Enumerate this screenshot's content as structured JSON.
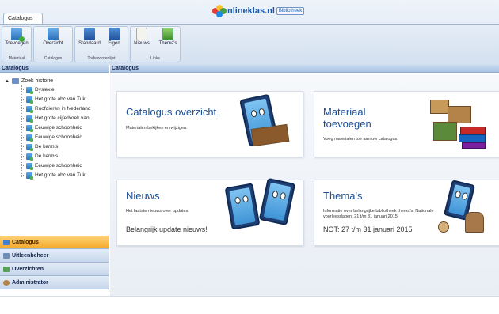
{
  "app": {
    "tab_label": "Catalogus",
    "brand_name": "nlineklas.nl",
    "brand_badge": "Bibliotheek"
  },
  "ribbon": {
    "buttons": [
      {
        "label": "Toevoegen",
        "icon": "add-document-icon"
      },
      {
        "label": "Overzicht",
        "icon": "documents-icon"
      },
      {
        "label": "Standaard",
        "icon": "tablet-icon"
      },
      {
        "label": "Eigen",
        "icon": "tablet-icon"
      },
      {
        "label": "Nieuws",
        "icon": "news-icon"
      },
      {
        "label": "Thema's",
        "icon": "image-icon"
      }
    ],
    "groups": [
      "Materiaal",
      "Catalogus",
      "Trefwoordenlijst",
      "Links"
    ]
  },
  "sidebar": {
    "header": "Catalogus",
    "tree_root": "Zoek historie",
    "tree_items": [
      "Dyslexie",
      "Het grote abc van Tuk",
      "Roofdieren in Nederland",
      "Het grote cijferboek van ...",
      "Eeuwige schoonheid",
      "Eeuwige schoonheid",
      "De kermis",
      "De kermis",
      "Eeuwige schoonheid",
      "Het grote abc van Tuk"
    ],
    "accordion": [
      {
        "label": "Catalogus",
        "active": true
      },
      {
        "label": "Uitleenbeheer",
        "active": false
      },
      {
        "label": "Overzichten",
        "active": false
      },
      {
        "label": "Administrator",
        "active": false
      }
    ]
  },
  "main": {
    "header": "Catalogus",
    "cards": [
      {
        "title": "Catalogus overzicht",
        "desc": "Materialen bekijken en wijzigen.",
        "extra": ""
      },
      {
        "title": "Materiaal toevoegen",
        "desc": "Voeg materialen toe aan uw catalogus.",
        "extra": ""
      },
      {
        "title": "Nieuws",
        "desc": "Het laatste nieuws over updates.",
        "extra": "Belangrijk update nieuws!"
      },
      {
        "title": "Thema's",
        "desc": "Informatie over belangrijke bibliotheek thema's: Nationale voorleesdagen: 21 t/m 31 januari 2015",
        "extra": "NOT: 27 t/m 31 januari 2015"
      }
    ]
  },
  "colors": {
    "accent": "#1b4f95",
    "active_nav": "#f4a82a",
    "header_blue": "#a9c3e4"
  }
}
